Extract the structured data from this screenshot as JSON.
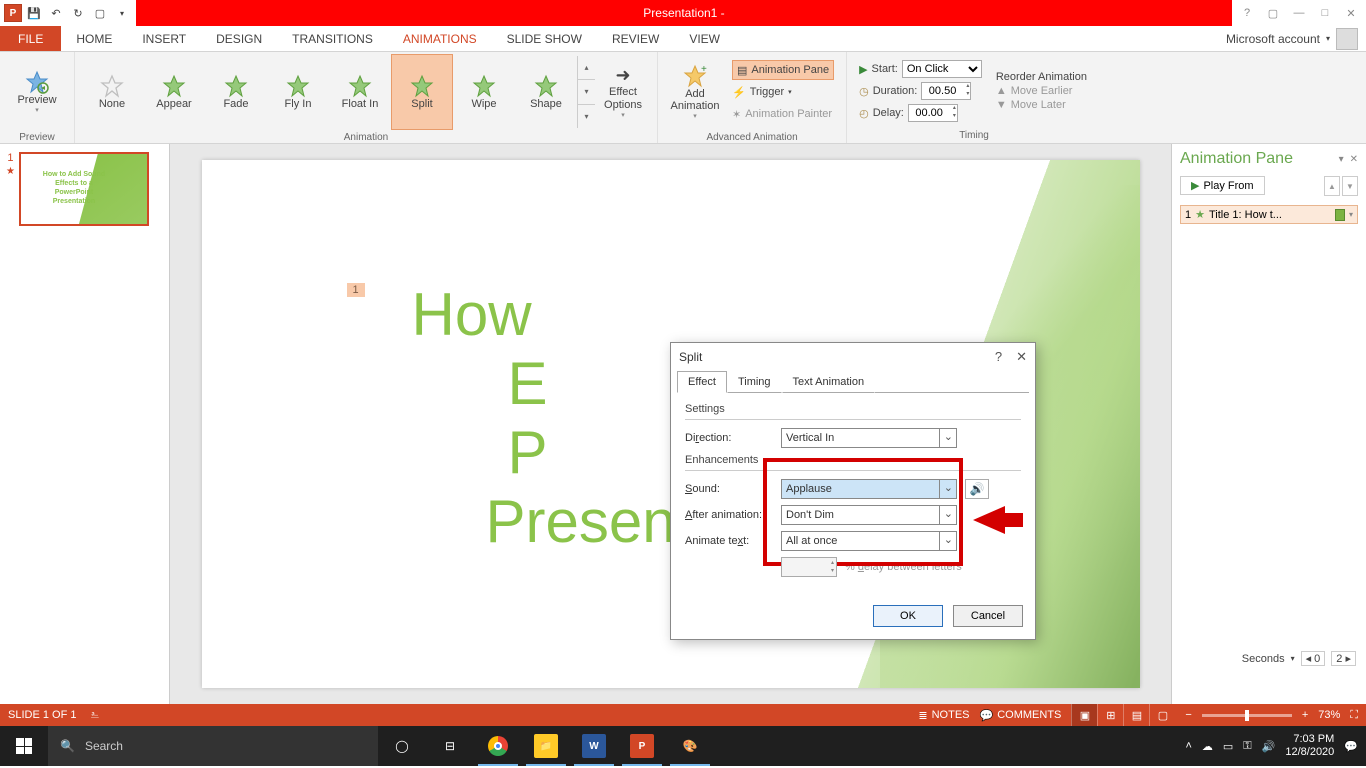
{
  "window": {
    "title": "Presentation1 - "
  },
  "tabs": {
    "file": "FILE",
    "items": [
      "HOME",
      "INSERT",
      "DESIGN",
      "TRANSITIONS",
      "ANIMATIONS",
      "SLIDE SHOW",
      "REVIEW",
      "VIEW"
    ],
    "active": "ANIMATIONS",
    "account": "Microsoft account"
  },
  "ribbon": {
    "preview": {
      "label": "Preview",
      "group": "Preview"
    },
    "animations": {
      "items": [
        "None",
        "Appear",
        "Fade",
        "Fly In",
        "Float In",
        "Split",
        "Wipe",
        "Shape"
      ],
      "selected": "Split",
      "group": "Animation",
      "effect_options": "Effect\nOptions"
    },
    "advanced": {
      "add": "Add\nAnimation",
      "pane": "Animation Pane",
      "trigger": "Trigger",
      "painter": "Animation Painter",
      "group": "Advanced Animation"
    },
    "timing": {
      "start_label": "Start:",
      "start_value": "On Click",
      "duration_label": "Duration:",
      "duration_value": "00.50",
      "delay_label": "Delay:",
      "delay_value": "00.00",
      "reorder_header": "Reorder Animation",
      "move_earlier": "Move Earlier",
      "move_later": "Move Later",
      "group": "Timing"
    }
  },
  "thumbnail": {
    "number": "1",
    "text": "How to Add Sound\nEffects to a\nPowerPoint\nPresentation"
  },
  "slide": {
    "tag": "1",
    "title_lines": [
      "How",
      "E",
      "P",
      "Presentation"
    ]
  },
  "anim_pane": {
    "title": "Animation Pane",
    "play_from": "Play From",
    "item_index": "1",
    "item_label": "Title 1: How t...",
    "seconds": "Seconds",
    "nav_prev": "0",
    "nav_next": "2"
  },
  "dialog": {
    "title": "Split",
    "tabs": [
      "Effect",
      "Timing",
      "Text Animation"
    ],
    "active_tab": "Effect",
    "settings_label": "Settings",
    "direction_label": "Direction:",
    "direction_value": "Vertical In",
    "enhancements_label": "Enhancements",
    "sound_label": "Sound:",
    "sound_value": "Applause",
    "after_label": "After animation:",
    "after_value": "Don't Dim",
    "animate_text_label": "Animate text:",
    "animate_text_value": "All at once",
    "delay_letters": "% delay between letters",
    "ok": "OK",
    "cancel": "Cancel"
  },
  "status": {
    "slide": "SLIDE 1 OF 1",
    "notes": "NOTES",
    "comments": "COMMENTS",
    "zoom": "73%"
  },
  "taskbar": {
    "search_placeholder": "Search",
    "time": "7:03 PM",
    "date": "12/8/2020"
  }
}
